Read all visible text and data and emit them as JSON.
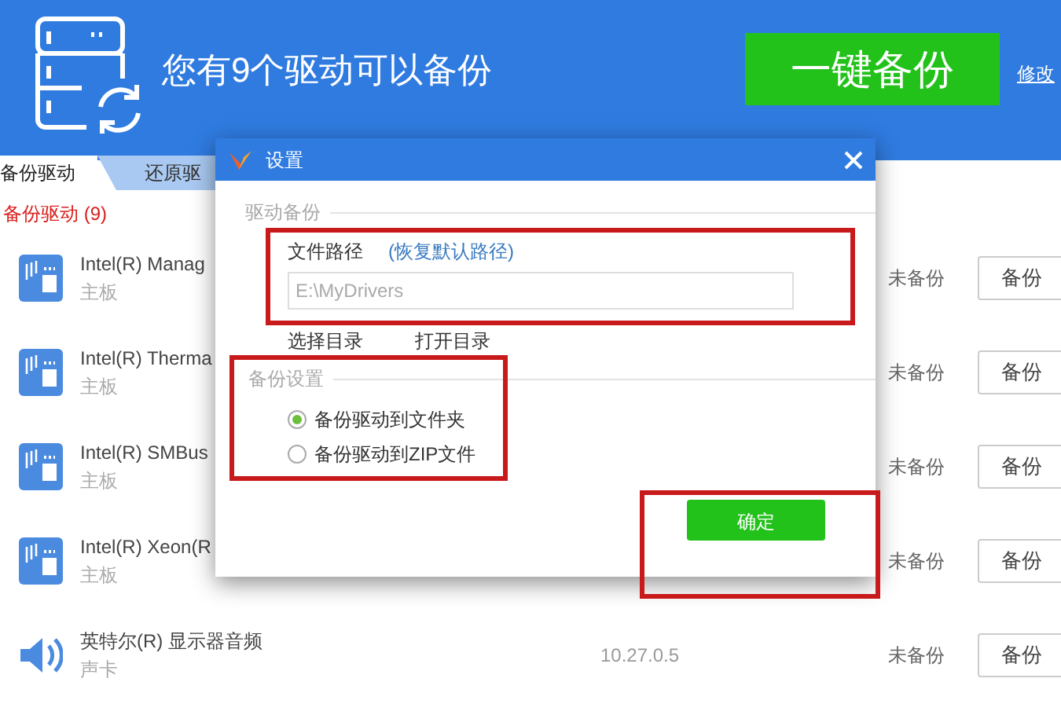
{
  "header": {
    "title": "您有9个驱动可以备份",
    "primary_button": "一键备份",
    "link": "修改"
  },
  "tabs": [
    {
      "label": "备份驱动",
      "selected": true
    },
    {
      "label": "还原驱",
      "selected": false
    }
  ],
  "list_heading": {
    "label": "备份驱动",
    "count": "(9)"
  },
  "drivers": [
    {
      "kind": "chip",
      "name": "Intel(R) Manag",
      "category": "主板",
      "status": "未备份",
      "button": "备份"
    },
    {
      "kind": "chip",
      "name": "Intel(R) Therma",
      "category": "主板",
      "status": "未备份",
      "button": "备份"
    },
    {
      "kind": "chip",
      "name": "Intel(R) SMBus",
      "category": "主板",
      "status": "未备份",
      "button": "备份"
    },
    {
      "kind": "chip",
      "name": "Intel(R) Xeon(R",
      "category": "主板",
      "status": "未备份",
      "button": "备份"
    },
    {
      "kind": "sound",
      "name": "英特尔(R) 显示器音频",
      "category": "声卡",
      "version": "10.27.0.5",
      "status": "未备份",
      "button": "备份"
    }
  ],
  "dialog": {
    "title": "设置",
    "driver_backup": {
      "legend": "驱动备份",
      "path_label": "文件路径",
      "reset_link": "(恢复默认路径)",
      "path_value": "E:\\MyDrivers",
      "links": [
        "选择目录",
        "打开目录"
      ]
    },
    "backup_settings": {
      "legend": "备份设置",
      "options": [
        {
          "label": "备份驱动到文件夹",
          "selected": true
        },
        {
          "label": "备份驱动到ZIP文件",
          "selected": false
        }
      ]
    },
    "ok_button": "确定"
  }
}
